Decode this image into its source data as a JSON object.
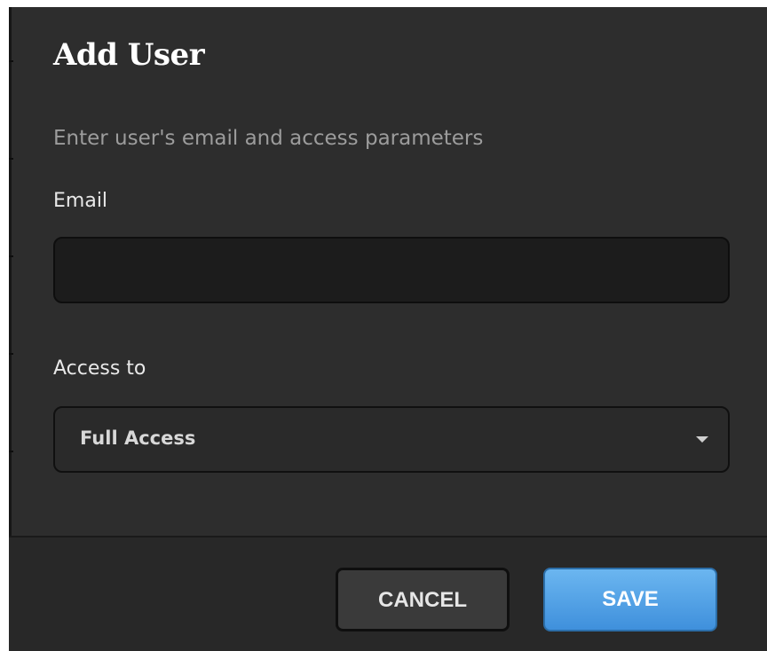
{
  "dialog": {
    "title": "Add User",
    "subtitle": "Enter user's email and access parameters"
  },
  "email": {
    "label": "Email",
    "value": "",
    "placeholder": ""
  },
  "access": {
    "label": "Access to",
    "selected": "Full Access",
    "icon": "chevron-down-icon"
  },
  "actions": {
    "cancel_label": "CANCEL",
    "save_label": "SAVE"
  },
  "colors": {
    "dialog_bg": "#2d2d2d",
    "field_bg": "#1c1c1c",
    "save_accent": "#4a9ee3"
  }
}
